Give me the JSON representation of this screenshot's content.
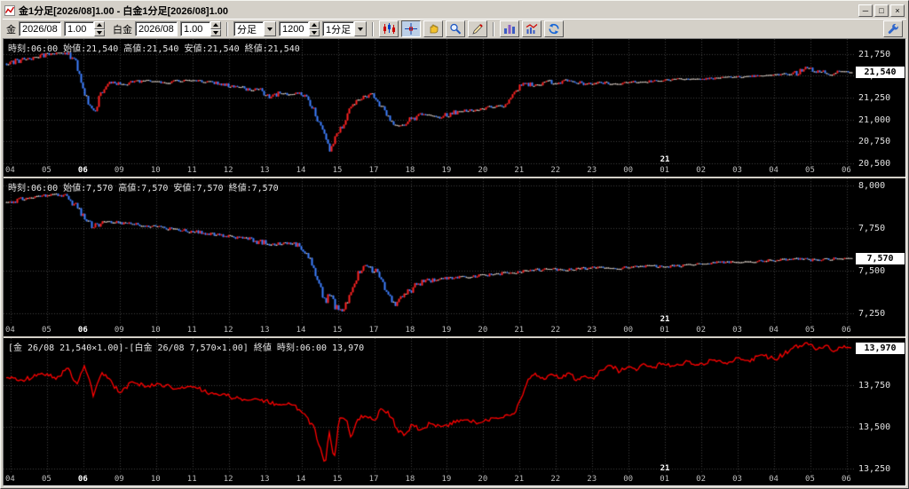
{
  "window": {
    "title": "金1分足[2026/08]1.00 - 白金1分足[2026/08]1.00",
    "controls": {
      "minimize": "─",
      "maximize": "□",
      "close": "×"
    }
  },
  "toolbar": {
    "gold": {
      "label": "金",
      "month": "2026/08",
      "multiplier": "1.00"
    },
    "platinum": {
      "label": "白金",
      "month": "2026/08",
      "multiplier": "1.00"
    },
    "period": {
      "type": "分足",
      "count": "1200",
      "timeframe": "1分足"
    },
    "icons": [
      "candlestick-chart-icon",
      "crosshair-icon",
      "hand-tool-icon",
      "zoom-tool-icon",
      "draw-tool-icon",
      "bar-chart-icon",
      "indicator-chart-icon",
      "refresh-icon",
      "settings-icon"
    ]
  },
  "axis": {
    "hours": [
      "04",
      "05",
      "06",
      "09",
      "10",
      "11",
      "12",
      "13",
      "14",
      "15",
      "17",
      "18",
      "19",
      "20",
      "21",
      "22",
      "23",
      "00",
      "01",
      "02",
      "03",
      "04",
      "05",
      "06"
    ],
    "bold_hour_index": 2,
    "date_marker": {
      "label": "21",
      "x_frac": 0.772
    }
  },
  "chart_data": [
    {
      "type": "candlestick",
      "name": "gold-1min",
      "header": "時刻:06:00 始値:21,540 高値:21,540 安値:21,540 終値:21,540",
      "current_price": "21,540",
      "current_value": 21540,
      "y_max": 21920,
      "y_min": 20480,
      "up_color": "#ff2222",
      "down_color": "#3e7fff",
      "y_ticks": [
        {
          "label": "21,750",
          "value": 21750
        },
        {
          "label": "21,500",
          "value": 21500
        },
        {
          "label": "21,250",
          "value": 21250
        },
        {
          "label": "21,000",
          "value": 21000
        },
        {
          "label": "20,750",
          "value": 20750
        },
        {
          "label": "20,500",
          "value": 20500
        }
      ],
      "waypoints": [
        [
          0,
          21640
        ],
        [
          0.02,
          21690
        ],
        [
          0.05,
          21745
        ],
        [
          0.068,
          21760
        ],
        [
          0.08,
          21710
        ],
        [
          0.09,
          21400
        ],
        [
          0.097,
          21150
        ],
        [
          0.103,
          21070
        ],
        [
          0.112,
          21310
        ],
        [
          0.12,
          21430
        ],
        [
          0.14,
          21400
        ],
        [
          0.16,
          21445
        ],
        [
          0.185,
          21420
        ],
        [
          0.21,
          21450
        ],
        [
          0.24,
          21430
        ],
        [
          0.26,
          21390
        ],
        [
          0.285,
          21350
        ],
        [
          0.3,
          21330
        ],
        [
          0.31,
          21250
        ],
        [
          0.322,
          21300
        ],
        [
          0.335,
          21280
        ],
        [
          0.348,
          21300
        ],
        [
          0.36,
          21180
        ],
        [
          0.37,
          20950
        ],
        [
          0.378,
          20800
        ],
        [
          0.383,
          20640
        ],
        [
          0.389,
          20800
        ],
        [
          0.397,
          20920
        ],
        [
          0.407,
          21130
        ],
        [
          0.42,
          21240
        ],
        [
          0.432,
          21290
        ],
        [
          0.444,
          21140
        ],
        [
          0.455,
          20990
        ],
        [
          0.465,
          20930
        ],
        [
          0.476,
          20990
        ],
        [
          0.49,
          21060
        ],
        [
          0.51,
          21020
        ],
        [
          0.53,
          21080
        ],
        [
          0.55,
          21110
        ],
        [
          0.572,
          21140
        ],
        [
          0.59,
          21160
        ],
        [
          0.603,
          21330
        ],
        [
          0.613,
          21420
        ],
        [
          0.625,
          21380
        ],
        [
          0.638,
          21450
        ],
        [
          0.652,
          21415
        ],
        [
          0.668,
          21445
        ],
        [
          0.683,
          21405
        ],
        [
          0.7,
          21425
        ],
        [
          0.72,
          21410
        ],
        [
          0.74,
          21430
        ],
        [
          0.76,
          21435
        ],
        [
          0.78,
          21450
        ],
        [
          0.8,
          21465
        ],
        [
          0.82,
          21460
        ],
        [
          0.84,
          21475
        ],
        [
          0.86,
          21485
        ],
        [
          0.88,
          21495
        ],
        [
          0.9,
          21505
        ],
        [
          0.92,
          21520
        ],
        [
          0.935,
          21535
        ],
        [
          0.948,
          21590
        ],
        [
          0.958,
          21560
        ],
        [
          0.972,
          21515
        ],
        [
          0.985,
          21545
        ],
        [
          1,
          21540
        ]
      ]
    },
    {
      "type": "candlestick",
      "name": "platinum-1min",
      "header": "時刻:06:00 始値:7,570 高値:7,570 安値:7,570 終値:7,570",
      "current_price": "7,570",
      "current_value": 7570,
      "y_max": 8040,
      "y_min": 7180,
      "up_color": "#ff2222",
      "down_color": "#3e7fff",
      "y_ticks": [
        {
          "label": "8,000",
          "value": 8000
        },
        {
          "label": "7,750",
          "value": 7750
        },
        {
          "label": "7,500",
          "value": 7500
        },
        {
          "label": "7,250",
          "value": 7250
        }
      ],
      "waypoints": [
        [
          0,
          7900
        ],
        [
          0.025,
          7925
        ],
        [
          0.055,
          7945
        ],
        [
          0.072,
          7935
        ],
        [
          0.083,
          7870
        ],
        [
          0.093,
          7790
        ],
        [
          0.103,
          7755
        ],
        [
          0.113,
          7790
        ],
        [
          0.13,
          7780
        ],
        [
          0.15,
          7770
        ],
        [
          0.17,
          7758
        ],
        [
          0.2,
          7740
        ],
        [
          0.23,
          7722
        ],
        [
          0.26,
          7702
        ],
        [
          0.29,
          7682
        ],
        [
          0.31,
          7652
        ],
        [
          0.33,
          7662
        ],
        [
          0.348,
          7645
        ],
        [
          0.36,
          7560
        ],
        [
          0.37,
          7420
        ],
        [
          0.377,
          7310
        ],
        [
          0.382,
          7360
        ],
        [
          0.389,
          7285
        ],
        [
          0.397,
          7268
        ],
        [
          0.406,
          7350
        ],
        [
          0.416,
          7480
        ],
        [
          0.428,
          7528
        ],
        [
          0.44,
          7478
        ],
        [
          0.45,
          7368
        ],
        [
          0.46,
          7300
        ],
        [
          0.471,
          7352
        ],
        [
          0.485,
          7420
        ],
        [
          0.5,
          7440
        ],
        [
          0.52,
          7452
        ],
        [
          0.54,
          7460
        ],
        [
          0.56,
          7468
        ],
        [
          0.58,
          7478
        ],
        [
          0.6,
          7488
        ],
        [
          0.62,
          7498
        ],
        [
          0.64,
          7508
        ],
        [
          0.66,
          7500
        ],
        [
          0.68,
          7510
        ],
        [
          0.7,
          7518
        ],
        [
          0.72,
          7510
        ],
        [
          0.74,
          7520
        ],
        [
          0.76,
          7528
        ],
        [
          0.78,
          7520
        ],
        [
          0.8,
          7530
        ],
        [
          0.82,
          7538
        ],
        [
          0.85,
          7548
        ],
        [
          0.88,
          7552
        ],
        [
          0.91,
          7560
        ],
        [
          0.94,
          7568
        ],
        [
          0.958,
          7558
        ],
        [
          0.978,
          7568
        ],
        [
          1,
          7570
        ]
      ]
    },
    {
      "type": "line",
      "name": "gold-platinum-spread",
      "header": "[金 26/08 21,540×1.00]-[白金 26/08 7,570×1.00] 終値 時刻:06:00 13,970",
      "current_price": "13,970",
      "current_value": 13970,
      "y_max": 14030,
      "y_min": 13220,
      "line_color": "#ff0000",
      "y_ticks": [
        {
          "label": "13,750",
          "value": 13750
        },
        {
          "label": "13,500",
          "value": 13500
        },
        {
          "label": "13,250",
          "value": 13250
        }
      ],
      "waypoints": [
        [
          0,
          13800
        ],
        [
          0.02,
          13775
        ],
        [
          0.04,
          13820
        ],
        [
          0.06,
          13790
        ],
        [
          0.073,
          13850
        ],
        [
          0.083,
          13755
        ],
        [
          0.093,
          13870
        ],
        [
          0.103,
          13690
        ],
        [
          0.113,
          13815
        ],
        [
          0.124,
          13775
        ],
        [
          0.134,
          13700
        ],
        [
          0.15,
          13770
        ],
        [
          0.165,
          13738
        ],
        [
          0.18,
          13760
        ],
        [
          0.2,
          13728
        ],
        [
          0.22,
          13742
        ],
        [
          0.24,
          13700
        ],
        [
          0.26,
          13690
        ],
        [
          0.28,
          13660
        ],
        [
          0.3,
          13668
        ],
        [
          0.32,
          13630
        ],
        [
          0.34,
          13642
        ],
        [
          0.354,
          13560
        ],
        [
          0.364,
          13500
        ],
        [
          0.371,
          13380
        ],
        [
          0.377,
          13265
        ],
        [
          0.382,
          13480
        ],
        [
          0.388,
          13310
        ],
        [
          0.394,
          13545
        ],
        [
          0.401,
          13560
        ],
        [
          0.408,
          13448
        ],
        [
          0.416,
          13540
        ],
        [
          0.425,
          13572
        ],
        [
          0.435,
          13538
        ],
        [
          0.445,
          13610
        ],
        [
          0.455,
          13568
        ],
        [
          0.463,
          13478
        ],
        [
          0.471,
          13458
        ],
        [
          0.481,
          13512
        ],
        [
          0.491,
          13480
        ],
        [
          0.502,
          13522
        ],
        [
          0.516,
          13500
        ],
        [
          0.53,
          13532
        ],
        [
          0.545,
          13542
        ],
        [
          0.56,
          13520
        ],
        [
          0.576,
          13552
        ],
        [
          0.59,
          13562
        ],
        [
          0.601,
          13582
        ],
        [
          0.61,
          13680
        ],
        [
          0.618,
          13790
        ],
        [
          0.626,
          13822
        ],
        [
          0.636,
          13780
        ],
        [
          0.646,
          13812
        ],
        [
          0.656,
          13790
        ],
        [
          0.666,
          13820
        ],
        [
          0.676,
          13782
        ],
        [
          0.686,
          13802
        ],
        [
          0.696,
          13782
        ],
        [
          0.706,
          13852
        ],
        [
          0.716,
          13872
        ],
        [
          0.726,
          13830
        ],
        [
          0.736,
          13862
        ],
        [
          0.746,
          13840
        ],
        [
          0.756,
          13872
        ],
        [
          0.766,
          13850
        ],
        [
          0.776,
          13880
        ],
        [
          0.79,
          13860
        ],
        [
          0.805,
          13892
        ],
        [
          0.82,
          13870
        ],
        [
          0.835,
          13902
        ],
        [
          0.85,
          13880
        ],
        [
          0.865,
          13912
        ],
        [
          0.88,
          13892
        ],
        [
          0.895,
          13932
        ],
        [
          0.91,
          13902
        ],
        [
          0.925,
          13952
        ],
        [
          0.94,
          13992
        ],
        [
          0.95,
          14002
        ],
        [
          0.96,
          13962
        ],
        [
          0.97,
          13992
        ],
        [
          0.98,
          13952
        ],
        [
          0.99,
          13982
        ],
        [
          1,
          13970
        ]
      ]
    }
  ]
}
